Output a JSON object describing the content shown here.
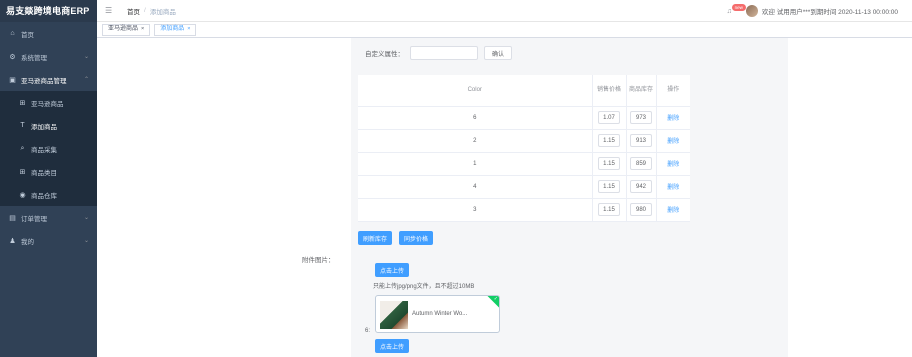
{
  "app": {
    "title": "易支燚跨境电商ERP"
  },
  "sidebar": {
    "items": [
      {
        "label": "首页",
        "icon": "home-icon"
      },
      {
        "label": "系统管理",
        "icon": "gear-icon"
      },
      {
        "label": "亚马逊商品管理",
        "icon": "box-icon"
      },
      {
        "label": "订单管理",
        "icon": "list-icon"
      },
      {
        "label": "我的",
        "icon": "user-icon"
      }
    ],
    "submenu": [
      {
        "label": "亚马逊商品",
        "icon": "grid-icon"
      },
      {
        "label": "添加商品",
        "icon": "text-icon"
      },
      {
        "label": "商品采集",
        "icon": "search-icon"
      },
      {
        "label": "商品类目",
        "icon": "grid-icon"
      },
      {
        "label": "商品仓库",
        "icon": "circle-icon"
      }
    ]
  },
  "header": {
    "breadcrumb": [
      "首页",
      "添加商品"
    ],
    "badge": "new",
    "welcome": "欢迎 试用用户***到期时间 2020-11-13 00:00:00"
  },
  "tags": [
    {
      "label": "亚马逊商品",
      "close": "×"
    },
    {
      "label": "添加商品",
      "close": "×"
    }
  ],
  "form": {
    "custom_attr_label": "自定义属性：",
    "custom_attr_value": "",
    "confirm_label": "确认"
  },
  "sku_table": {
    "headers": [
      "Color",
      "销售价格",
      "商品库存",
      "操作"
    ],
    "rows": [
      {
        "color": "6",
        "price": "1.07",
        "stock": "973",
        "op": "删除"
      },
      {
        "color": "2",
        "price": "1.15",
        "stock": "913",
        "op": "删除"
      },
      {
        "color": "1",
        "price": "1.15",
        "stock": "859",
        "op": "删除"
      },
      {
        "color": "4",
        "price": "1.15",
        "stock": "942",
        "op": "删除"
      },
      {
        "color": "3",
        "price": "1.15",
        "stock": "980",
        "op": "删除"
      }
    ]
  },
  "bulk": {
    "stock_label": "刷新库存",
    "price_label": "同步价格"
  },
  "images": {
    "label": "附件图片：",
    "upload_label": "点击上传",
    "tip": "只能上传jpg/png文件，且不超过10MB",
    "file_name": "Autumn Winter Wo...",
    "row_num": "6:",
    "upload_label_2": "点击上传"
  },
  "colors": {
    "sidebar_bg": "#304156",
    "primary": "#409eff",
    "success": "#13ce66",
    "danger": "#f56c6c"
  }
}
